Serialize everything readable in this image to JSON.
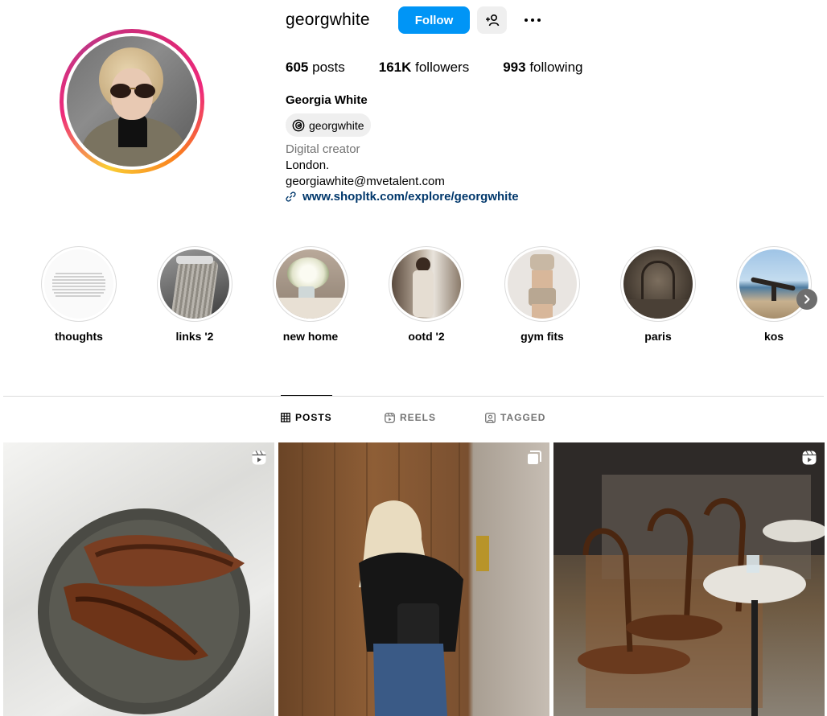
{
  "profile": {
    "username": "georgwhite",
    "follow_label": "Follow",
    "stats": [
      {
        "value": "605",
        "label": "posts"
      },
      {
        "value": "161K",
        "label": "followers"
      },
      {
        "value": "993",
        "label": "following"
      }
    ],
    "full_name": "Georgia White",
    "threads_handle": "georgwhite",
    "category": "Digital creator",
    "bio_lines": [
      "London.",
      "georgiawhite@mvetalent.com"
    ],
    "link": "www.shopltk.com/explore/georgwhite"
  },
  "highlights": [
    {
      "label": "thoughts"
    },
    {
      "label": "links '2"
    },
    {
      "label": "new home"
    },
    {
      "label": "ootd '2"
    },
    {
      "label": "gym fits"
    },
    {
      "label": "paris"
    },
    {
      "label": "kos"
    }
  ],
  "tabs": [
    {
      "label": "POSTS",
      "icon": "grid-icon",
      "active": true
    },
    {
      "label": "REELS",
      "icon": "reels-icon",
      "active": false
    },
    {
      "label": "TAGGED",
      "icon": "tagged-icon",
      "active": false
    }
  ],
  "posts": [
    {
      "type": "reel",
      "icon": "reel-icon"
    },
    {
      "type": "carousel",
      "icon": "carousel-icon"
    },
    {
      "type": "reel",
      "icon": "reel-icon"
    }
  ],
  "colors": {
    "accent": "#0095f6",
    "link": "#00376b",
    "muted": "#737373",
    "border": "#dbdbdb"
  }
}
